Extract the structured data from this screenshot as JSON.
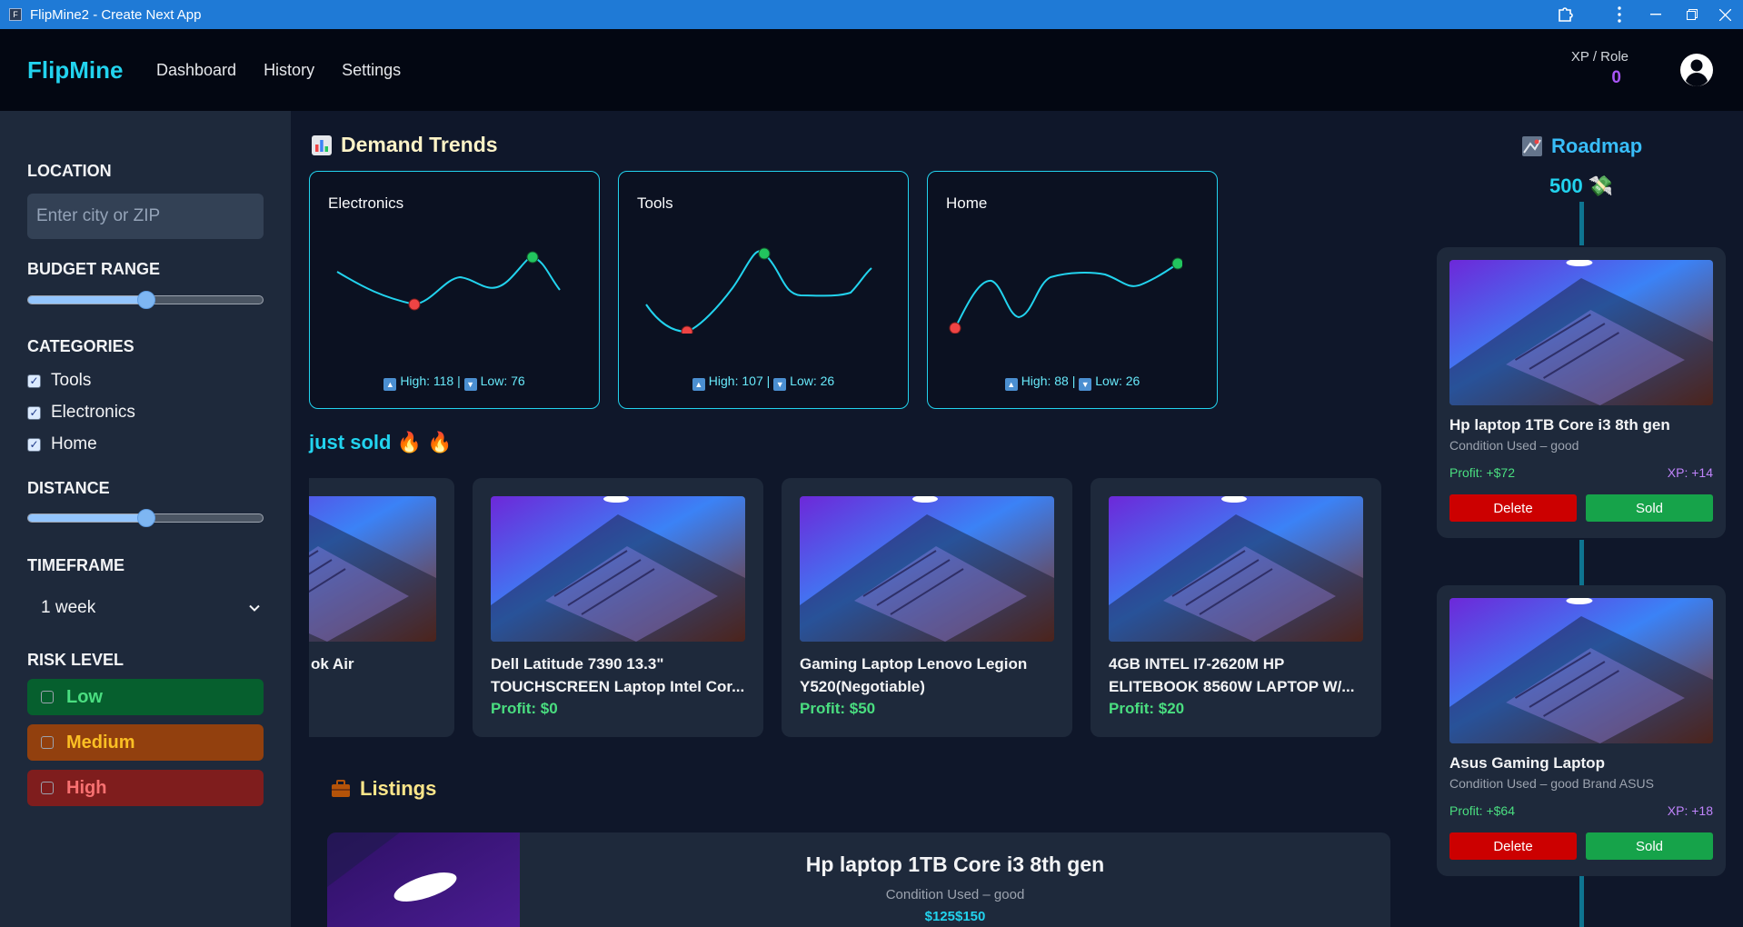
{
  "window": {
    "title": "FlipMine2 - Create Next App",
    "app_icon_letter": "F"
  },
  "nav": {
    "brand": "FlipMine",
    "links": [
      "Dashboard",
      "History",
      "Settings"
    ],
    "xp_label": "XP / Role",
    "xp_value": "0"
  },
  "sidebar": {
    "location_label": "LOCATION",
    "location_placeholder": "Enter city or ZIP",
    "budget_label": "BUDGET RANGE",
    "budget_level": 0.5,
    "categories_label": "CATEGORIES",
    "categories": [
      {
        "label": "Tools",
        "checked": true
      },
      {
        "label": "Electronics",
        "checked": true
      },
      {
        "label": "Home",
        "checked": true
      }
    ],
    "distance_label": "DISTANCE",
    "distance_level": 0.5,
    "timeframe_label": "TIMEFRAME",
    "timeframe_value": "1 week",
    "risk_label": "RISK LEVEL",
    "risks": [
      {
        "label": "Low",
        "bg": "#065f2e",
        "fg": "#4ade80"
      },
      {
        "label": "Medium",
        "bg": "#92400e",
        "fg": "#fbbf24"
      },
      {
        "label": "High",
        "bg": "#7f1d1d",
        "fg": "#f87171"
      }
    ]
  },
  "trends": {
    "title": "Demand Trends",
    "icon": "bar-chart-icon",
    "cards": [
      {
        "name": "Electronics",
        "high": "High: 118",
        "sep": "|",
        "low": "Low: 76"
      },
      {
        "name": "Tools",
        "high": "High: 107",
        "sep": "|",
        "low": "Low: 26"
      },
      {
        "name": "Home",
        "high": "High: 88",
        "sep": "|",
        "low": "Low: 26"
      }
    ]
  },
  "just_sold": {
    "title": "just sold",
    "icon": "fire-icon",
    "items": [
      {
        "name": "ok Air",
        "profit": ""
      },
      {
        "name": "Dell Latitude 7390 13.3\" TOUCHSCREEN Laptop Intel Cor...",
        "profit": "Profit: $0"
      },
      {
        "name": "Gaming Laptop Lenovo Legion Y520(Negotiable)",
        "profit": "Profit: $50"
      },
      {
        "name": "4GB INTEL I7-2620M HP ELITEBOOK 8560W LAPTOP W/...",
        "profit": "Profit: $20"
      }
    ]
  },
  "listings": {
    "title": "Listings",
    "icon": "briefcase-icon",
    "first": {
      "name": "Hp laptop 1TB Core i3 8th gen",
      "condition": "Condition Used – good",
      "price": "$125$150"
    }
  },
  "roadmap": {
    "title": "Roadmap",
    "icon": "map-icon",
    "goal": "500",
    "goal_icon": "money-icon",
    "cards": [
      {
        "name": "Hp laptop 1TB Core i3 8th gen",
        "condition": "Condition Used – good",
        "profit": "Profit: +$72",
        "xp": "XP: +14",
        "delete": "Delete",
        "sold": "Sold"
      },
      {
        "name": "Asus Gaming Laptop",
        "condition": "Condition Used – good Brand ASUS",
        "profit": "Profit: +$64",
        "xp": "XP: +18",
        "delete": "Delete",
        "sold": "Sold"
      }
    ]
  },
  "colors": {
    "accent": "#22d3ee",
    "titlebar": "#1f7ad6",
    "nav_bg": "#030712",
    "sidebar_bg": "#1e293b",
    "main_bg": "#0f172a"
  }
}
